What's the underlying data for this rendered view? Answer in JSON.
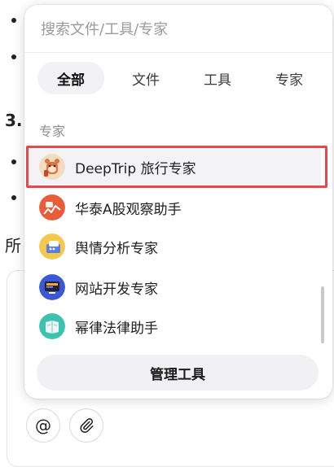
{
  "background": {
    "heading_fragment": "3.",
    "text_fragment": "所",
    "mention_button": {
      "icon": "at-icon",
      "glyph": "@"
    },
    "attach_button": {
      "icon": "paperclip-icon",
      "glyph": "📎"
    }
  },
  "popup": {
    "search": {
      "placeholder": "搜索文件/工具/专家",
      "value": ""
    },
    "tabs": [
      {
        "label": "全部",
        "active": true
      },
      {
        "label": "文件",
        "active": false
      },
      {
        "label": "工具",
        "active": false
      },
      {
        "label": "专家",
        "active": false
      }
    ],
    "section_label": "专家",
    "experts": [
      {
        "name": "DeepTrip 旅行专家",
        "icon": "deeptrip-bear-icon",
        "selected": true
      },
      {
        "name": "华泰A股观察助手",
        "icon": "stock-chart-icon",
        "selected": false
      },
      {
        "name": "舆情分析专家",
        "icon": "public-opinion-icon",
        "selected": false
      },
      {
        "name": "网站开发专家",
        "icon": "monitor-code-icon",
        "selected": false
      },
      {
        "name": "幂律法律助手",
        "icon": "law-book-icon",
        "selected": false
      }
    ],
    "manage_button": "管理工具"
  },
  "colors": {
    "highlight_border": "#e5484d",
    "active_tab_bg": "#f2f2f4",
    "manage_button_bg": "#f1f1f3"
  }
}
